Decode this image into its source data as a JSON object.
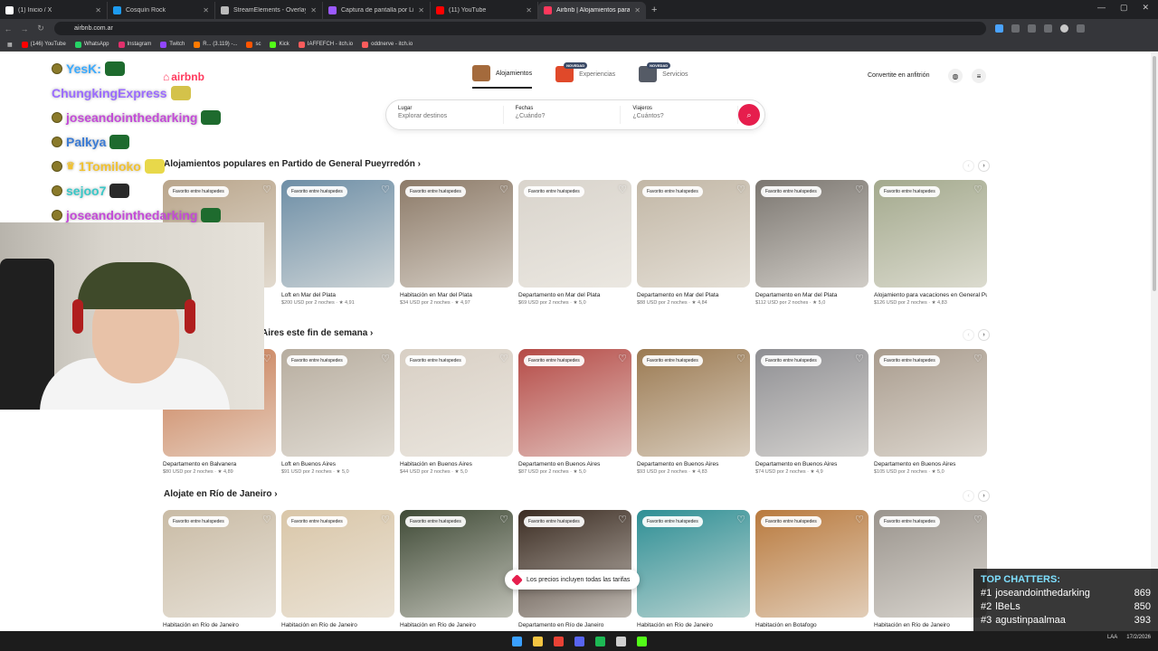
{
  "browser": {
    "tabs": [
      {
        "title": "(1) Inicio / X",
        "color": "#ffffff",
        "active": false
      },
      {
        "title": "Cosquín Rock",
        "color": "#1d9bf0",
        "active": false
      },
      {
        "title": "StreamElements - Overlays",
        "color": "#bbbbbb",
        "active": false
      },
      {
        "title": "Captura de pantalla por Lightshot",
        "color": "#9b59ff",
        "active": false
      },
      {
        "title": "(11) YouTube",
        "color": "#ff0000",
        "active": false
      },
      {
        "title": "Airbnb | Alojamientos para vacaciones",
        "color": "#ff385c",
        "active": true
      }
    ],
    "new_tab": "+",
    "url": "airbnb.com.ar",
    "bookmarks": [
      {
        "label": "(146) YouTube",
        "color": "#ff0000"
      },
      {
        "label": "WhatsApp",
        "color": "#25d366"
      },
      {
        "label": "Instagram",
        "color": "#e1306c"
      },
      {
        "label": "Twitch",
        "color": "#9146ff"
      },
      {
        "label": "R... (3.119) -...",
        "color": "#ff7a00"
      },
      {
        "label": "sc",
        "color": "#ff5500"
      },
      {
        "label": "Kick",
        "color": "#53fc18"
      },
      {
        "label": "IAFFEFCH - itch.io",
        "color": "#fa5c5c"
      },
      {
        "label": "oddnerve - itch.io",
        "color": "#fa5c5c"
      }
    ]
  },
  "airbnb": {
    "logo": "airbnb",
    "nav": [
      {
        "label": "Alojamientos",
        "badge": "",
        "color": "#a46a3c",
        "active": true
      },
      {
        "label": "Experiencias",
        "badge": "NOVEDAD",
        "color": "#e0492a",
        "active": false
      },
      {
        "label": "Servicios",
        "badge": "NOVEDAD",
        "color": "#555b66",
        "active": false
      }
    ],
    "host_link": "Convertite en anfitrión",
    "search": {
      "place_label": "Lugar",
      "place_placeholder": "Explorar destinos",
      "dates_label": "Fechas",
      "dates_placeholder": "¿Cuándo?",
      "guests_label": "Viajeros",
      "guests_placeholder": "¿Cuántos?"
    },
    "sections": [
      {
        "title": "Alojamientos populares en Partido de General Pueyrredón ›",
        "cards": [
          {
            "title": "",
            "price": "",
            "color": "#b9a58b"
          },
          {
            "title": "Loft en Mar del Plata",
            "price": "$200 USD por 2 noches · ★ 4,91",
            "color": "#6d8ea6"
          },
          {
            "title": "Habitación en Mar del Plata",
            "price": "$34 USD por 2 noches · ★ 4,97",
            "color": "#8c7a68"
          },
          {
            "title": "Departamento en Mar del Plata",
            "price": "$69 USD por 2 noches · ★ 5,0",
            "color": "#d9d4cc"
          },
          {
            "title": "Departamento en Mar del Plata",
            "price": "$88 USD por 2 noches · ★ 4,84",
            "color": "#c2b7a6"
          },
          {
            "title": "Departamento en Mar del Plata",
            "price": "$112 USD por 2 noches · ★ 5,0",
            "color": "#7b7670"
          },
          {
            "title": "Alojamiento para vacaciones en General Pueyrredón",
            "price": "$126 USD por 2 noches · ★ 4,83",
            "color": "#a3a98d"
          }
        ]
      },
      {
        "title": "Aires este fin de semana ›",
        "cards": [
          {
            "title": "Departamento en Balvanera",
            "price": "$80 USD por 2 noches · ★ 4,89",
            "color": "#c7794f"
          },
          {
            "title": "Loft en Buenos Aires",
            "price": "$91 USD por 2 noches · ★ 5,0",
            "color": "#b7ad9f"
          },
          {
            "title": "Habitación en Buenos Aires",
            "price": "$44 USD por 2 noches · ★ 5,0",
            "color": "#d8cfc4"
          },
          {
            "title": "Departamento en Buenos Aires",
            "price": "$87 USD por 2 noches · ★ 5,0",
            "color": "#b54a46"
          },
          {
            "title": "Departamento en Buenos Aires",
            "price": "$93 USD por 2 noches · ★ 4,83",
            "color": "#9b7a52"
          },
          {
            "title": "Departamento en Buenos Aires",
            "price": "$74 USD por 2 noches · ★ 4,9",
            "color": "#8f8f93"
          },
          {
            "title": "Departamento en Buenos Aires",
            "price": "$105 USD por 2 noches · ★ 5,0",
            "color": "#a99c8e"
          }
        ]
      },
      {
        "title": "Alojate en Río de Janeiro ›",
        "cards": [
          {
            "title": "Habitación en Río de Janeiro",
            "price": "",
            "color": "#c9bba5"
          },
          {
            "title": "Habitación en Río de Janeiro",
            "price": "",
            "color": "#d9c6a8"
          },
          {
            "title": "Habitación en Río de Janeiro",
            "price": "",
            "color": "#3f4a36"
          },
          {
            "title": "Departamento en Río de Janeiro",
            "price": "",
            "color": "#3b2c22"
          },
          {
            "title": "Habitación en Río de Janeiro",
            "price": "",
            "color": "#2e8f95"
          },
          {
            "title": "Habitación en Botafogo",
            "price": "",
            "color": "#b97a3e"
          },
          {
            "title": "Habitación en Río de Janeiro",
            "price": "",
            "color": "#9a948d"
          }
        ]
      }
    ],
    "fav_badge": "Favorito entre huéspedes",
    "toast": "Los precios incluyen todas las tarifas"
  },
  "stream": {
    "chat": [
      {
        "name": "YesK:",
        "color": "#3aaaff"
      },
      {
        "name": "ChungkingExpress",
        "color": "#9b6bff"
      },
      {
        "name": "joseandointhedarking",
        "color": "#c44ad8"
      },
      {
        "name": "Palkya",
        "color": "#3a7bd5"
      },
      {
        "name": "1Tomiloko",
        "color": "#f1c232"
      },
      {
        "name": "sejoo7",
        "color": "#39c8c8"
      },
      {
        "name": "joseandointhedarking",
        "color": "#c44ad8"
      }
    ],
    "top_chatters": {
      "title": "TOP CHATTERS:",
      "rows": [
        {
          "rank": "#1",
          "name": "joseandointhedarking",
          "count": "869"
        },
        {
          "rank": "#2",
          "name": "lBeLs",
          "count": "850"
        },
        {
          "rank": "#3",
          "name": "agustinpaalmaa",
          "count": "393"
        }
      ]
    }
  },
  "taskbar": {
    "icons": [
      {
        "name": "windows-start-icon",
        "color": "#3aa0ff"
      },
      {
        "name": "file-explorer-icon",
        "color": "#f4c542"
      },
      {
        "name": "chrome-icon",
        "color": "#e94235"
      },
      {
        "name": "discord-icon",
        "color": "#5865f2"
      },
      {
        "name": "spotify-icon",
        "color": "#1db954"
      },
      {
        "name": "obs-icon",
        "color": "#d0d0d0"
      },
      {
        "name": "kick-icon",
        "color": "#53fc18"
      }
    ],
    "lang": "LAA",
    "date": "17/2/2026"
  }
}
